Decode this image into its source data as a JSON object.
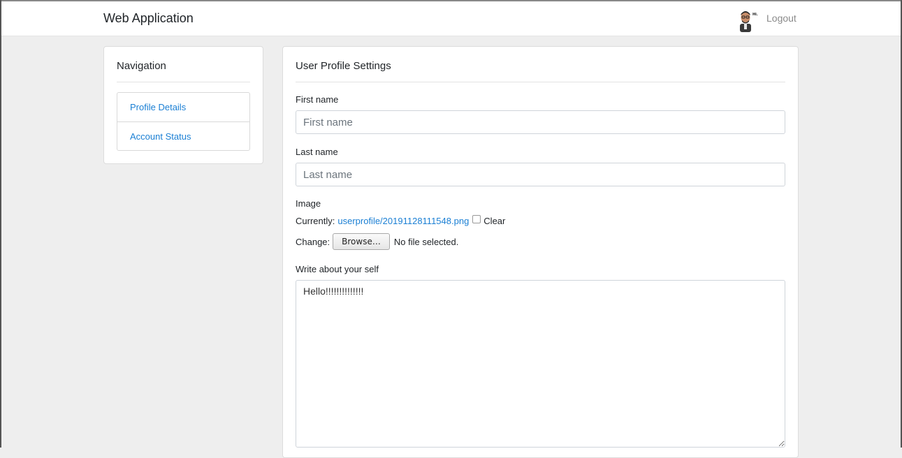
{
  "navbar": {
    "brand": "Web Application",
    "avatar_icon": "avatar-hi-icon",
    "logout_label": "Logout"
  },
  "nav_card": {
    "title": "Navigation",
    "items": [
      {
        "label": "Profile Details"
      },
      {
        "label": "Account Status"
      }
    ]
  },
  "form": {
    "title": "User Profile Settings",
    "first_name": {
      "label": "First name",
      "placeholder": "First name",
      "value": ""
    },
    "last_name": {
      "label": "Last name",
      "placeholder": "Last name",
      "value": ""
    },
    "image": {
      "label": "Image",
      "currently_label": "Currently:",
      "current_file": "userprofile/20191128111548.png",
      "clear_label": "Clear",
      "clear_checked": false,
      "change_label": "Change:",
      "browse_label": "Browse…",
      "no_file_text": "No file selected."
    },
    "about": {
      "label": "Write about your self",
      "value": "Hello!!!!!!!!!!!!!!"
    }
  },
  "colors": {
    "link": "#1a7fd4",
    "background": "#eeeeee"
  }
}
